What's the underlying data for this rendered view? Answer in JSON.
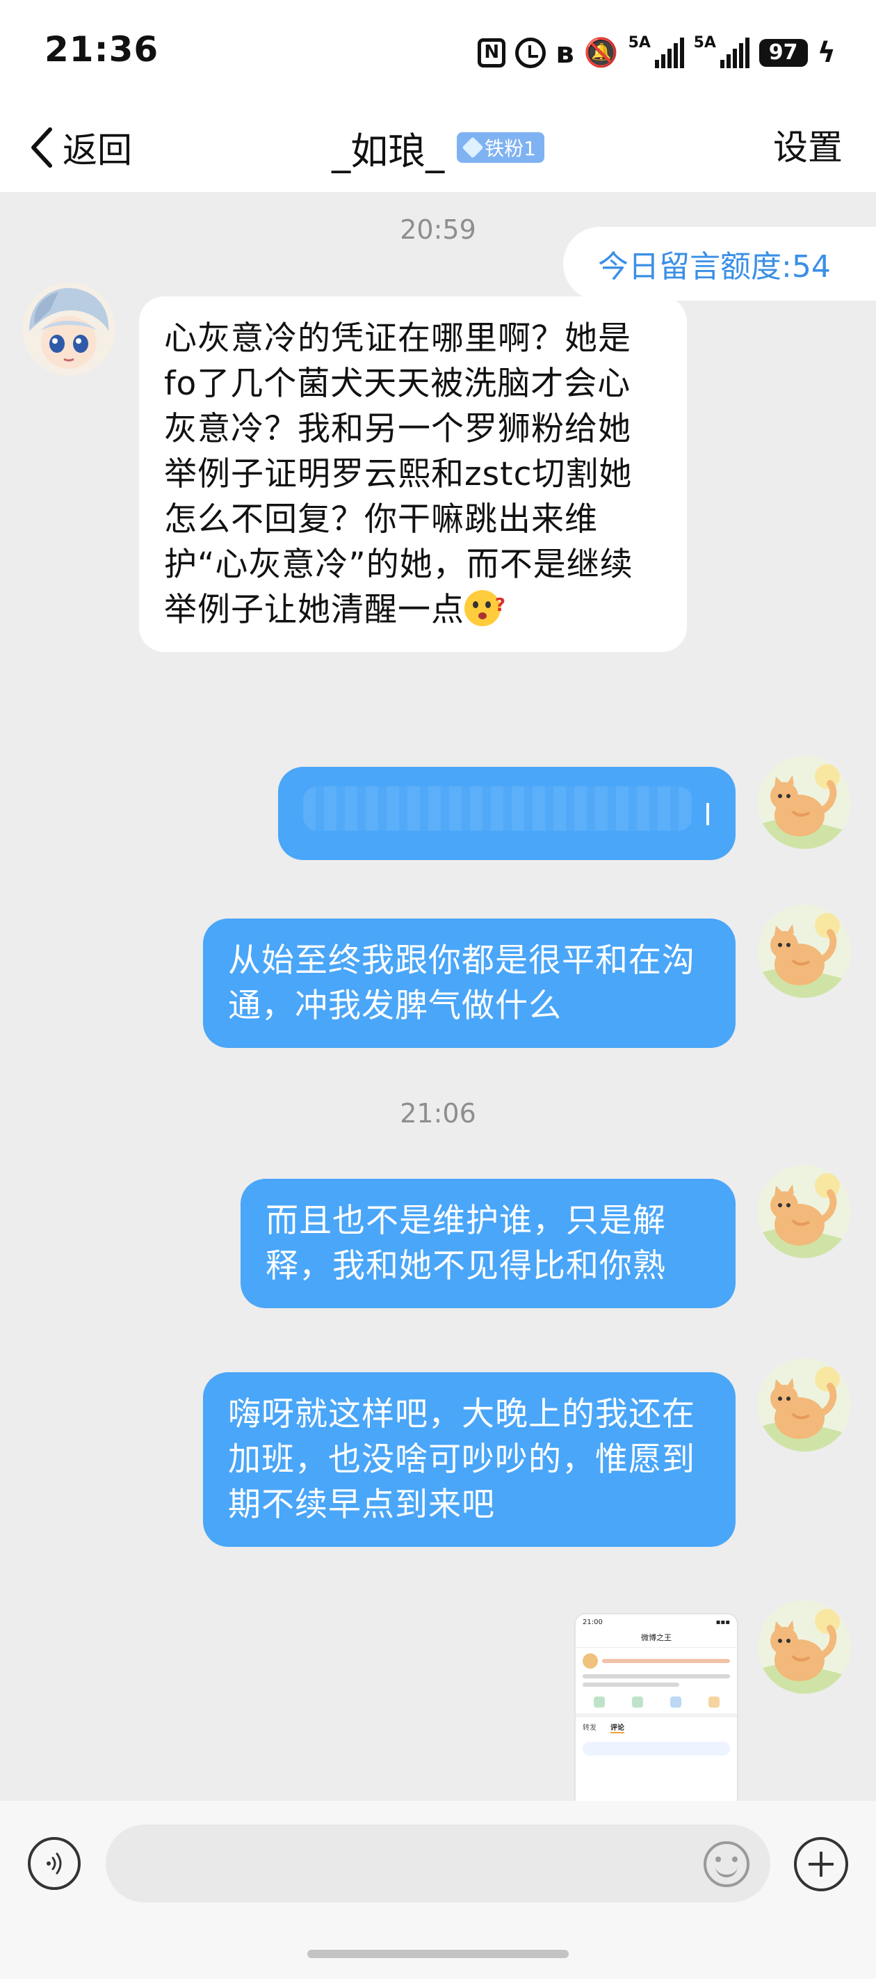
{
  "status_bar": {
    "time": "21:36",
    "network_1": "5A",
    "network_2": "5A",
    "battery": "97",
    "icons": [
      "nfc-icon",
      "alarm-icon",
      "bluetooth-icon",
      "mute-icon",
      "signal-icon",
      "signal-icon",
      "battery-icon",
      "charging-icon"
    ]
  },
  "header": {
    "back_label": "返回",
    "title": "_如琅_",
    "badge": "铁粉1",
    "settings_label": "设置"
  },
  "chat": {
    "quota": "今日留言额度:54",
    "messages": [
      {
        "type": "timestamp",
        "text": "20:59"
      },
      {
        "type": "message",
        "side": "left",
        "text": "心灰意冷的凭证在哪里啊？她是fo了几个菌犬天天被洗脑才会心灰意冷？我和另一个罗狮粉给她举例子证明罗云熙和zstc切割她怎么不回复？你干嘛跳出来维护“心灰意冷”的她，而不是继续举例子让她清醒一点",
        "emoji": "thinking-face-emoji"
      },
      {
        "type": "message",
        "side": "right",
        "text": "",
        "blurred": true
      },
      {
        "type": "message",
        "side": "right",
        "text": "从始至终我跟你都是很平和在沟通，冲我发脾气做什么"
      },
      {
        "type": "timestamp",
        "text": "21:06"
      },
      {
        "type": "message",
        "side": "right",
        "text": "而且也不是维护谁，只是解释，我和她不见得比和你熟"
      },
      {
        "type": "message",
        "side": "right",
        "text": "嗨呀就这样吧，大晚上的我还在加班，也没啥可吵吵的，惟愿到期不续早点到来吧"
      },
      {
        "type": "image",
        "side": "right",
        "alt": "screenshot-thumbnail"
      }
    ]
  },
  "thumbnail": {
    "time": "21:00",
    "heading": "微博之王",
    "tab_1": "评论",
    "tab_2": "转发"
  },
  "input": {
    "placeholder": "",
    "value": ""
  },
  "colors": {
    "accent_blue": "#4aa6f8",
    "quota_text": "#3a8fe6",
    "badge_bg": "#7fb2f2",
    "background": "#ededed"
  }
}
